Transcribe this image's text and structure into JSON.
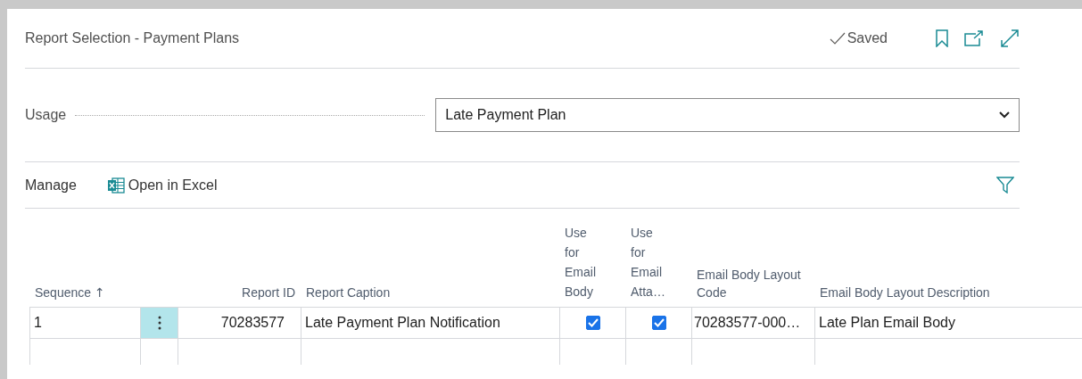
{
  "window": {
    "title": "Report Selection - Payment Plans",
    "status": "Saved"
  },
  "usage": {
    "label": "Usage",
    "value": "Late Payment Plan"
  },
  "actions": {
    "manage": "Manage",
    "open_in_excel": "Open in Excel"
  },
  "table": {
    "columns": [
      {
        "label": "Sequence",
        "sort_mark": "↑"
      },
      {
        "label": "Report ID"
      },
      {
        "label": "Report Caption"
      },
      {
        "label": "Use for Email Body"
      },
      {
        "label": "Use for Email Atta…"
      },
      {
        "label": "Email Body Layout Code"
      },
      {
        "label": "Email Body Layout Description"
      }
    ],
    "rows": [
      {
        "sequence": "1",
        "selected": true,
        "report_id": "70283577",
        "report_caption": "Late Payment Plan Notification",
        "use_for_email_body": true,
        "use_for_email_attachment": true,
        "layout_code": "70283577-000…",
        "layout_description": "Late Plan Email Body"
      }
    ]
  }
}
